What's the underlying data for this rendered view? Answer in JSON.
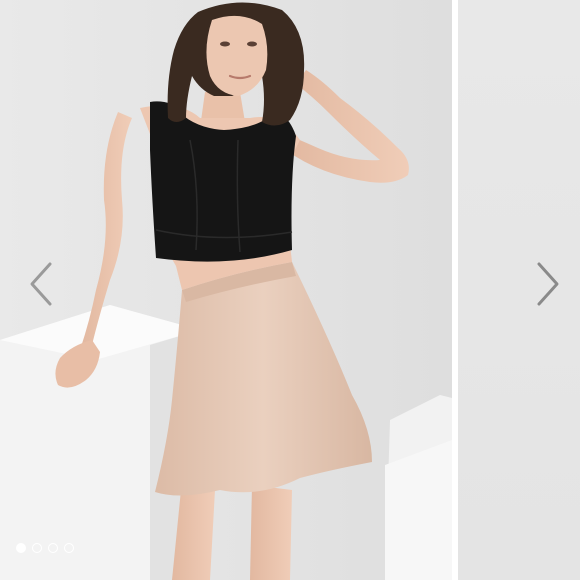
{
  "carousel": {
    "current_index": 0,
    "total_slides": 4,
    "dots": [
      {
        "active": true
      },
      {
        "active": false
      },
      {
        "active": false
      },
      {
        "active": false
      }
    ],
    "icons": {
      "previous": "chevron-left-icon",
      "next": "chevron-right-icon"
    }
  },
  "photo": {
    "subject": "model-in-black-crop-top-and-blush-flared-skirt",
    "colors": {
      "background": "#e6e6e6",
      "top": "#151515",
      "skirt": "#e3c7b4",
      "skin": "#e8c2ac",
      "hair": "#3a2a20",
      "arrow": "#9a9a9a"
    }
  }
}
